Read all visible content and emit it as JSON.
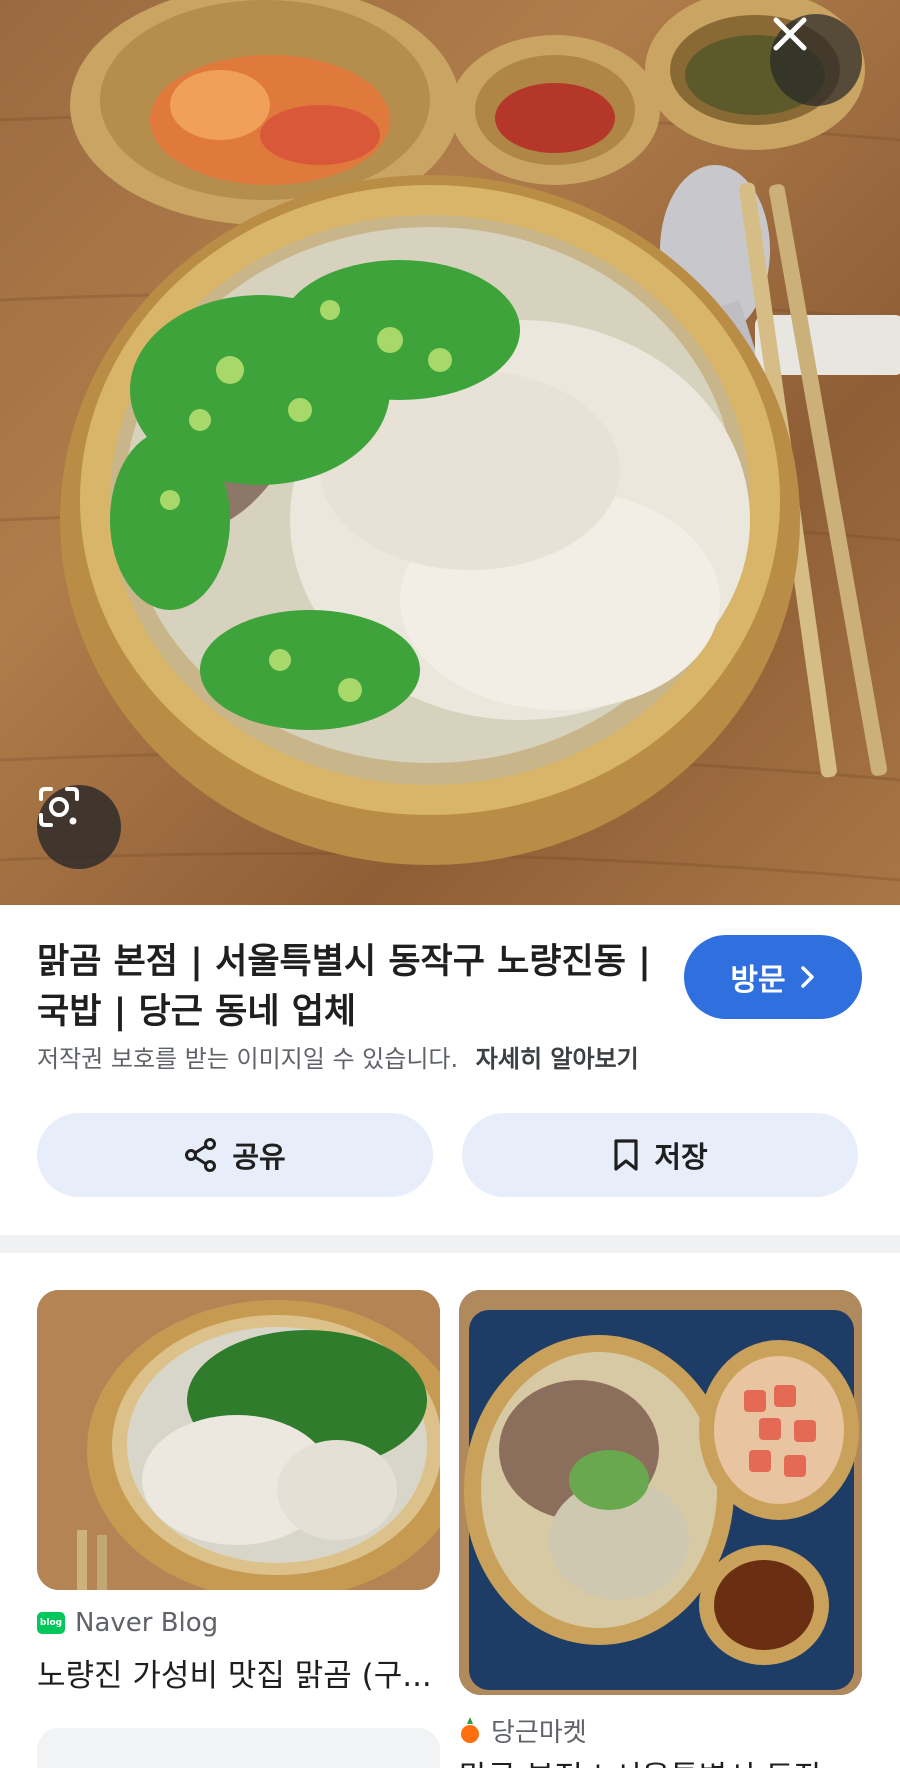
{
  "hero": {
    "image_alt": "",
    "close_icon": "close-icon",
    "lens_icon": "google-lens-icon"
  },
  "result": {
    "title": "맑곰 본점 | 서울특별시 동작구 노량진동 | 국밥 | 당근 동네 업체",
    "visit_label": "방문",
    "copyright_notice": "저작권 보호를 받는 이미지일 수 있습니다.",
    "learn_more": "자세히 알아보기",
    "share_label": "공유",
    "save_label": "저장"
  },
  "related": [
    {
      "source": "Naver Blog",
      "source_icon": "naver-blog-icon",
      "title": "노량진 가성비 맛집 맑곰 (구..."
    },
    {
      "source": "당근마켓",
      "source_icon": "carrot-icon",
      "title": "맑곰 본점 | 서울특별시 동작"
    }
  ],
  "colors": {
    "accent": "#2f6fde",
    "button_bg": "#e8eef9",
    "naver_green": "#03c75a",
    "carrot_orange": "#ff6f0f"
  }
}
